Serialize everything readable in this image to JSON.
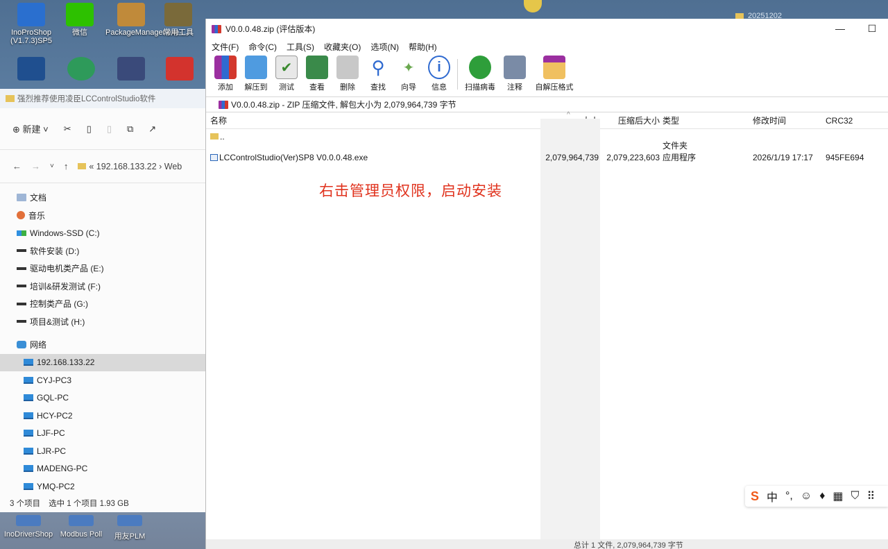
{
  "desktop": {
    "top_icons": [
      {
        "label": "InoProShop (V1.7.3)SP5"
      },
      {
        "label": "微信"
      },
      {
        "label": "PackageManager.exe-..."
      },
      {
        "label": "常用工具"
      }
    ],
    "tray_folder_label": "20251202",
    "bottom_icons": [
      {
        "label": "InoDriverShop"
      },
      {
        "label": "Modbus Poll"
      },
      {
        "label": "用友PLM"
      }
    ]
  },
  "explorer": {
    "tab_title": "强烈推荐使用凌臣LCControlStudio软件",
    "new_label": "新建",
    "address_path": "« 192.168.133.22 › Web",
    "nav": [
      {
        "label": "文档",
        "icon": "document-icon"
      },
      {
        "label": "音乐",
        "icon": "music-icon"
      },
      {
        "label": "Windows-SSD (C:)",
        "icon": "windows-drive-icon"
      },
      {
        "label": "软件安装 (D:)",
        "icon": "drive-icon"
      },
      {
        "label": "驱动电机类产品 (E:)",
        "icon": "drive-icon"
      },
      {
        "label": "培训&研发测试 (F:)",
        "icon": "drive-icon"
      },
      {
        "label": "控制类产品 (G:)",
        "icon": "drive-icon"
      },
      {
        "label": "项目&测试 (H:)",
        "icon": "drive-icon"
      }
    ],
    "network_label": "网络",
    "network_items": [
      {
        "label": "192.168.133.22",
        "selected": true
      },
      {
        "label": "CYJ-PC3",
        "selected": false
      },
      {
        "label": "GQL-PC",
        "selected": false
      },
      {
        "label": "HCY-PC2",
        "selected": false
      },
      {
        "label": "LJF-PC",
        "selected": false
      },
      {
        "label": "LJR-PC",
        "selected": false
      },
      {
        "label": "MADENG-PC",
        "selected": false
      },
      {
        "label": "YMQ-PC2",
        "selected": false
      }
    ],
    "status_count": "3 个项目",
    "status_selected": "选中 1 个项目 1.93 GB"
  },
  "winrar": {
    "title": "V0.0.0.48.zip (评估版本)",
    "window_minimize": "—",
    "window_maximize": "☐",
    "menu": [
      "文件(F)",
      "命令(C)",
      "工具(S)",
      "收藏夹(O)",
      "选项(N)",
      "帮助(H)"
    ],
    "toolbar": [
      {
        "label": "添加",
        "icon": "add-icon",
        "color": "#c0392b"
      },
      {
        "label": "解压到",
        "icon": "extract-folder-icon",
        "color": "#3a86d4"
      },
      {
        "label": "测试",
        "icon": "test-clipboard-icon",
        "color": "#5a8f3a"
      },
      {
        "label": "查看",
        "icon": "view-book-icon",
        "color": "#2f7a3f"
      },
      {
        "label": "删除",
        "icon": "delete-trash-icon",
        "color": "#8a8a8a"
      },
      {
        "label": "查找",
        "icon": "find-magnifier-icon",
        "color": "#2f6ad0"
      },
      {
        "label": "向导",
        "icon": "wizard-wand-icon",
        "color": "#6aa84f"
      },
      {
        "label": "信息",
        "icon": "info-icon",
        "color": "#2f6ad0"
      },
      {
        "label": "扫描病毒",
        "icon": "virus-scan-icon",
        "color": "#2e9e3a"
      },
      {
        "label": "注释",
        "icon": "comment-icon",
        "color": "#5b6f8c"
      },
      {
        "label": "自解压格式",
        "icon": "sfx-archive-icon",
        "color": "#d9a13a"
      }
    ],
    "address": "V0.0.0.48.zip - ZIP 压缩文件, 解包大小为 2,079,964,739 字节",
    "columns": {
      "name": "名称",
      "size": "大小",
      "packed": "压缩后大小",
      "type": "类型",
      "mtime": "修改时间",
      "crc": "CRC32"
    },
    "rows": [
      {
        "name": "..",
        "size": "",
        "packed": "",
        "type": "文件夹",
        "mtime": "",
        "crc": ""
      },
      {
        "name": "LCControlStudio(Ver)SP8 V0.0.0.48.exe",
        "size": "2,079,964,739",
        "packed": "2,079,223,603",
        "type": "应用程序",
        "mtime": "2026/1/19 17:17",
        "crc": "945FE694"
      }
    ],
    "annotation": "右击管理员权限，启动安装",
    "status": "总计 1 文件, 2,079,964,739 字节"
  },
  "ime": {
    "logo": "S",
    "mode": "中",
    "items": [
      "punctuation-icon",
      "emoji-icon",
      "voice-icon",
      "keyboard-icon",
      "skin-icon",
      "toolbox-icon"
    ]
  }
}
